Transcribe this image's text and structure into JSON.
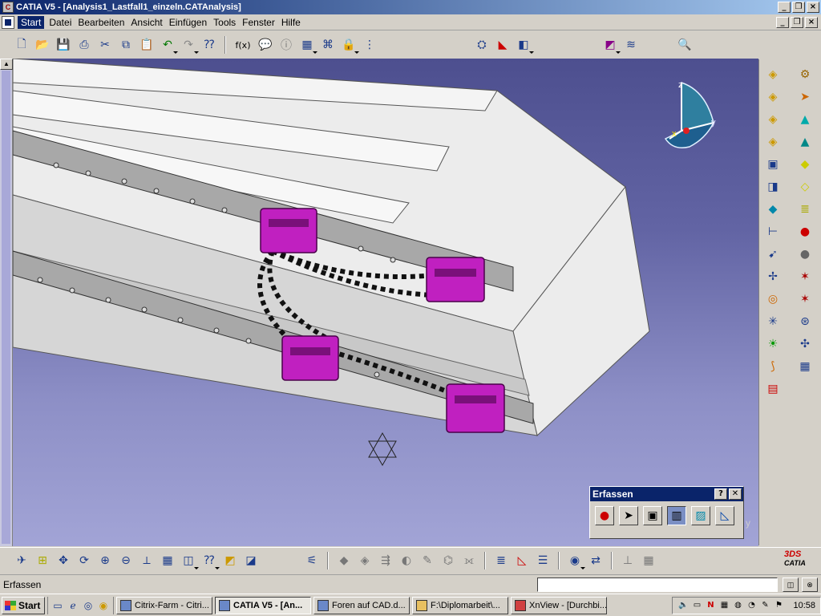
{
  "window": {
    "title": "CATIA V5 - [Analysis1_Lastfall1_einzeln.CATAnalysis]",
    "app_icon": "catia-icon"
  },
  "menu": {
    "items": [
      "Start",
      "Datei",
      "Bearbeiten",
      "Ansicht",
      "Einfügen",
      "Tools",
      "Fenster",
      "Hilfe"
    ]
  },
  "top_toolbar": {
    "icons": [
      "new-icon",
      "open-icon",
      "save-icon",
      "print-icon",
      "cut-icon",
      "copy-icon",
      "paste-icon",
      "undo-icon",
      "redo-icon",
      "whats-this-icon",
      "formula-icon",
      "knowledge-icon",
      "table-icon",
      "tree-icon",
      "lock-icon",
      "catalog-icon",
      "mesh-icon",
      "analysis-icon",
      "property-icon",
      "sensor-icon",
      "signal-icon",
      "search-icon"
    ],
    "formula_label": "f(x)"
  },
  "compass": {
    "axis_x": "x",
    "axis_y": "y",
    "axis_z": "z"
  },
  "corner_label": "y",
  "palette": {
    "title": "Erfassen",
    "help": "?",
    "close": "✕",
    "buttons": [
      "record-icon",
      "select-icon",
      "capture-icon",
      "album-icon",
      "image-icon",
      "measure-icon"
    ]
  },
  "right_toolbar": {
    "col1": [
      "layer1-icon",
      "layer2-icon",
      "layer3-icon",
      "layer4-icon",
      "part-icon",
      "assembly-icon",
      "surface-icon",
      "clamp-icon",
      "fix-icon",
      "force-icon",
      "contact-icon",
      "rigid-icon",
      "mesh-icon",
      "tetra-icon",
      "material-icon"
    ],
    "col2": [
      "gear-icon",
      "cursor-icon",
      "pyramid-icon",
      "cone-icon",
      "cube-icon",
      "plate-icon",
      "stack-icon",
      "traffic-light-icon",
      "sphere-icon",
      "bug-icon",
      "virtual-icon",
      "sensor-icon",
      "graph-icon",
      "calculator-icon"
    ]
  },
  "bottom_toolbar": {
    "icons": [
      "fly-icon",
      "fit-all-icon",
      "pan-icon",
      "rotate-icon",
      "zoom-in-icon",
      "zoom-out-icon",
      "normal-view-icon",
      "multi-view-icon",
      "iso-view-icon",
      "hide-show-icon",
      "swap-icon",
      "view-mode-icon",
      "analysis-icon",
      "compute-icon",
      "image-icon",
      "deform-icon",
      "stress-icon",
      "displace-icon",
      "animate-icon",
      "report-icon",
      "cut-plane-icon",
      "sensor-icon",
      "catalog-icon",
      "distance-icon",
      "measure-icon",
      "swap-view-icon"
    ],
    "logo_top": "3DS",
    "logo_bottom": "CATIA"
  },
  "status": {
    "text": "Erfassen",
    "cmd_value": ""
  },
  "taskbar": {
    "start": "Start",
    "tasks": [
      {
        "label": "Citrix-Farm - Citri...",
        "active": false
      },
      {
        "label": "CATIA V5 - [An...",
        "active": true
      },
      {
        "label": "Foren auf CAD.d...",
        "active": false
      },
      {
        "label": "F:\\Diplomarbeit\\...",
        "active": false
      },
      {
        "label": "XnView - [Durchbi...",
        "active": false
      }
    ],
    "tray": [
      "speaker-icon",
      "network-icon",
      "n-icon",
      "monitor-icon",
      "search-icon",
      "clock-icon",
      "pen-icon",
      "flag-icon"
    ],
    "tray_n": "N",
    "clock": "10:58"
  }
}
